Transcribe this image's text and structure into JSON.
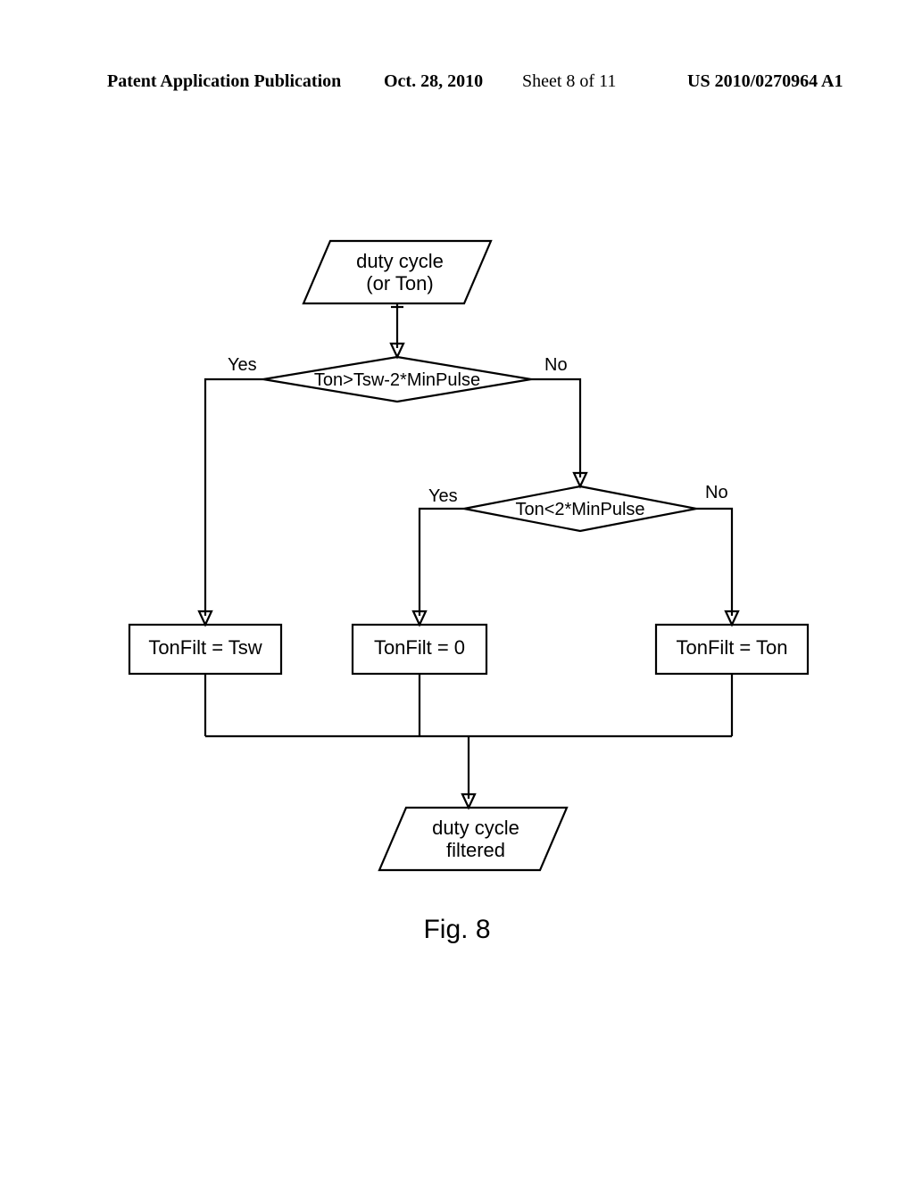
{
  "header": {
    "publication_label": "Patent Application Publication",
    "date": "Oct. 28, 2010",
    "sheet": "Sheet 8 of 11",
    "pub_number": "US 2010/0270964 A1"
  },
  "chart_data": {
    "type": "flowchart",
    "nodes": [
      {
        "id": "in",
        "shape": "parallelogram",
        "text": [
          "duty cycle",
          "(or Ton)"
        ]
      },
      {
        "id": "d1",
        "shape": "diamond",
        "text": [
          "Ton>Tsw-2*MinPulse"
        ]
      },
      {
        "id": "d2",
        "shape": "diamond",
        "text": [
          "Ton<2*MinPulse"
        ]
      },
      {
        "id": "p1",
        "shape": "rect",
        "text": [
          "TonFilt = Tsw"
        ]
      },
      {
        "id": "p2",
        "shape": "rect",
        "text": [
          "TonFilt = 0"
        ]
      },
      {
        "id": "p3",
        "shape": "rect",
        "text": [
          "TonFilt = Ton"
        ]
      },
      {
        "id": "out",
        "shape": "parallelogram",
        "text": [
          "duty cycle",
          "filtered"
        ]
      }
    ],
    "edges": [
      {
        "from": "in",
        "to": "d1",
        "label": ""
      },
      {
        "from": "d1",
        "to": "p1",
        "label": "Yes"
      },
      {
        "from": "d1",
        "to": "d2",
        "label": "No"
      },
      {
        "from": "d2",
        "to": "p2",
        "label": "Yes"
      },
      {
        "from": "d2",
        "to": "p3",
        "label": "No"
      },
      {
        "from": "p1",
        "to": "out",
        "label": ""
      },
      {
        "from": "p2",
        "to": "out",
        "label": ""
      },
      {
        "from": "p3",
        "to": "out",
        "label": ""
      }
    ]
  },
  "labels": {
    "yes": "Yes",
    "no": "No"
  },
  "figure_caption": "Fig.  8"
}
